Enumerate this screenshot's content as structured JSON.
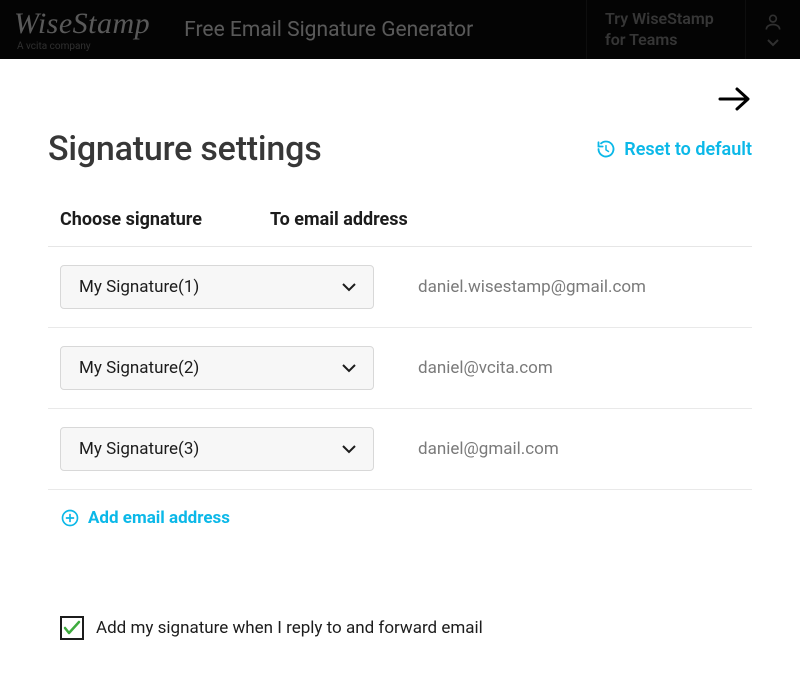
{
  "header": {
    "logo": "WiseStamp",
    "logo_sub": "A vcita company",
    "tagline": "Free Email Signature Generator",
    "cta": "Try WiseStamp for Teams"
  },
  "page": {
    "title": "Signature settings",
    "reset": "Reset to default",
    "col_choose": "Choose signature",
    "col_email": "To email address",
    "add_email": "Add email address",
    "checkbox_label": "Add my signature when I reply to and forward email"
  },
  "rows": [
    {
      "signature": "My Signature(1)",
      "email": "daniel.wisestamp@gmail.com"
    },
    {
      "signature": "My Signature(2)",
      "email": "daniel@vcita.com"
    },
    {
      "signature": "My Signature(3)",
      "email": "daniel@gmail.com"
    }
  ]
}
